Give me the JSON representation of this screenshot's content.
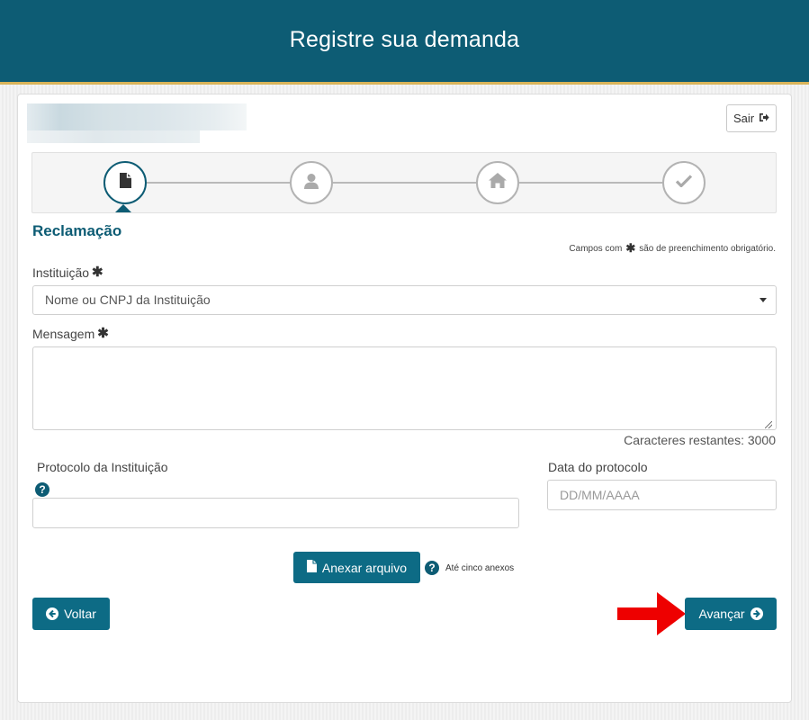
{
  "header": {
    "title": "Registre sua demanda"
  },
  "toolbar": {
    "exit_label": "Sair",
    "exit_icon": "sign-out-icon"
  },
  "stepper": {
    "steps": [
      {
        "icon": "document-icon",
        "state": "active"
      },
      {
        "icon": "user-icon",
        "state": "inactive"
      },
      {
        "icon": "home-icon",
        "state": "inactive"
      },
      {
        "icon": "check-icon",
        "state": "inactive"
      }
    ]
  },
  "form": {
    "section_title": "Reclamação",
    "required_note_prefix": "Campos com",
    "required_note_suffix": "são de preenchimento obrigatório.",
    "institution": {
      "label": "Instituição",
      "placeholder": "Nome ou CNPJ da Instituição"
    },
    "message": {
      "label": "Mensagem",
      "value": ""
    },
    "chars_left": "Caracteres restantes: 3000",
    "protocol": {
      "label": "Protocolo da Instituição",
      "value": ""
    },
    "protocol_date": {
      "label": "Data do protocolo",
      "placeholder": "DD/MM/AAAA"
    },
    "attach": {
      "label": "Anexar arquivo",
      "note": "Até cinco anexos"
    }
  },
  "nav": {
    "back_label": "Voltar",
    "next_label": "Avançar"
  },
  "colors": {
    "primary": "#0d5c74",
    "button": "#0d6b85",
    "accent_gold": "#d9b45a",
    "arrow_red": "#ee0000"
  }
}
